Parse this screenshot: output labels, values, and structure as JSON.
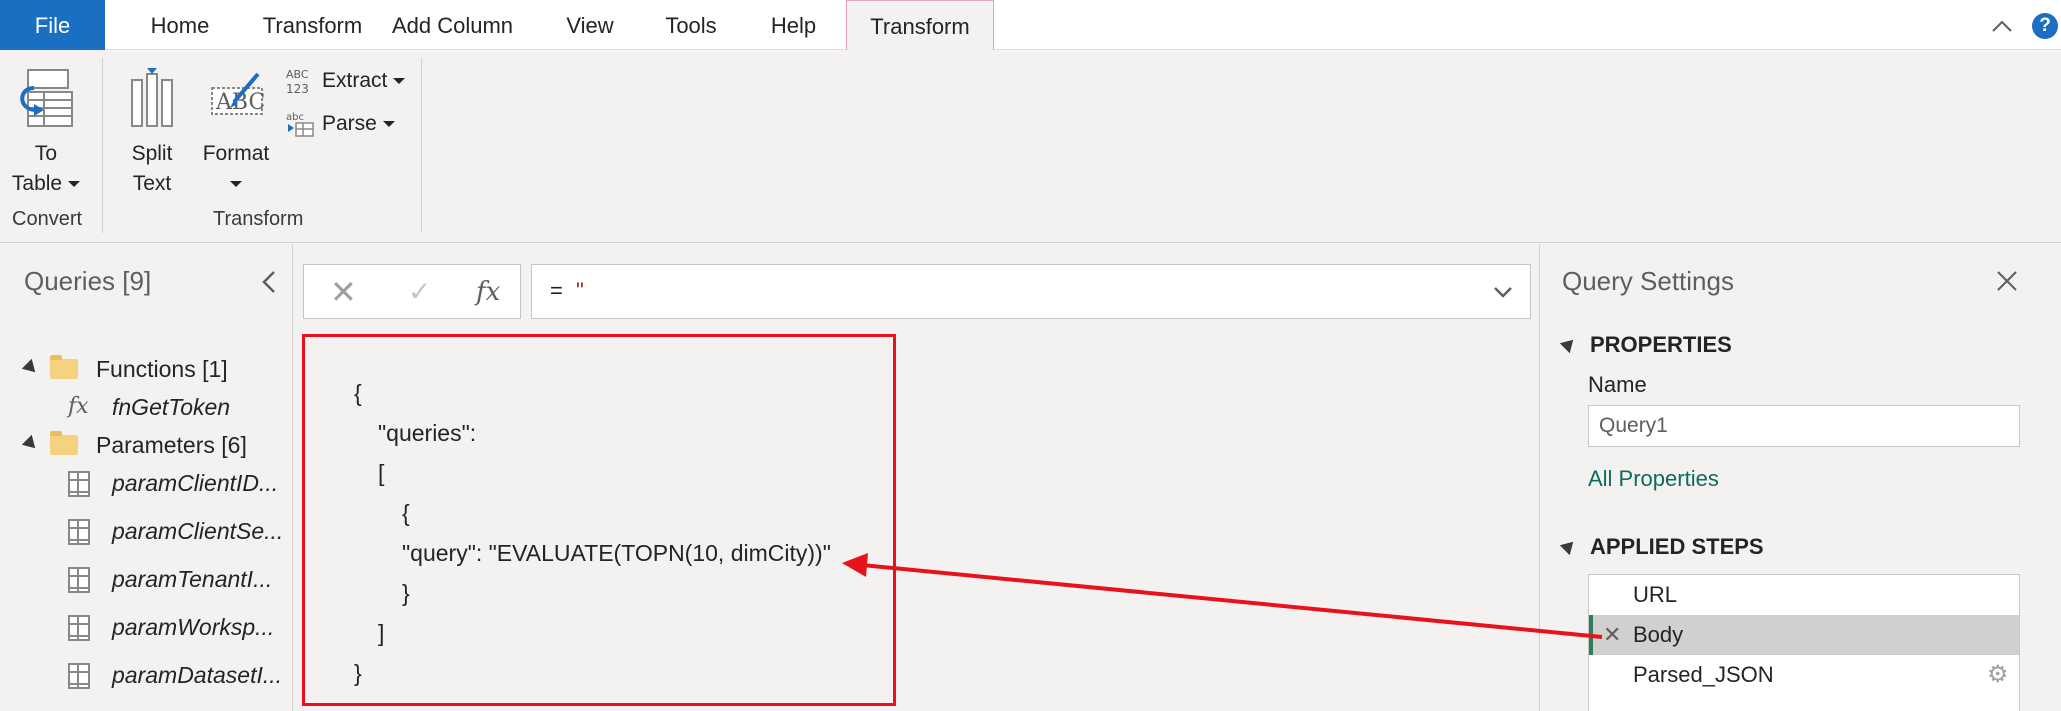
{
  "tabs": {
    "file": "File",
    "home": "Home",
    "transform": "Transform",
    "add_column": "Add Column",
    "view": "View",
    "tools": "Tools",
    "help": "Help",
    "contextual_transform": "Transform"
  },
  "help_glyph": "?",
  "ribbon": {
    "to_table": {
      "line1": "To",
      "line2": "Table"
    },
    "split_text": {
      "line1": "Split",
      "line2": "Text"
    },
    "format": "Format",
    "extract": "Extract",
    "parse": "Parse",
    "group_convert": "Convert",
    "group_transform": "Transform"
  },
  "queries": {
    "title": "Queries [9]",
    "folders": [
      {
        "label": "Functions [1]",
        "items": [
          {
            "label": "fnGetToken",
            "icon": "fx"
          }
        ]
      },
      {
        "label": "Parameters [6]",
        "items": [
          {
            "label": "paramClientID...",
            "icon": "table"
          },
          {
            "label": "paramClientSe...",
            "icon": "table"
          },
          {
            "label": "paramTenantI...",
            "icon": "table"
          },
          {
            "label": "paramWorksp...",
            "icon": "table"
          },
          {
            "label": "paramDatasetI...",
            "icon": "table"
          }
        ]
      }
    ]
  },
  "formula_bar": {
    "fx": "fx",
    "equals": "=",
    "value": "\""
  },
  "json_lines": [
    "{",
    "\"queries\":",
    "[",
    "{",
    "\"query\": \"EVALUATE(TOPN(10, dimCity))\"",
    "}",
    "]",
    "}"
  ],
  "settings": {
    "title": "Query Settings",
    "properties_header": "PROPERTIES",
    "name_label": "Name",
    "name_value": "Query1",
    "all_properties": "All Properties",
    "applied_steps_header": "APPLIED STEPS",
    "steps": [
      "URL",
      "Body",
      "Parsed_JSON"
    ]
  },
  "colors": {
    "accent": "#1b6fc2",
    "annotation": "#e8121a",
    "link": "#0f6b5c"
  }
}
